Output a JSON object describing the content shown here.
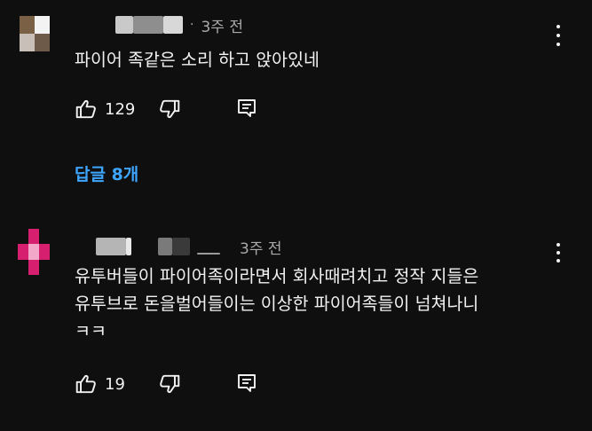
{
  "comments": [
    {
      "time": "3주 전",
      "text": "파이어 족같은 소리 하고 앉아있네",
      "likes": "129",
      "replies_label": "답글 8개",
      "avatar_colors": [
        "#7a6045",
        "#ffffff",
        "#c8c0b8",
        "#6e5a48"
      ]
    },
    {
      "time": "3주 전",
      "text": "유투버들이 파이어족이라면서 회사때려치고 정작 지들은\n유투브로 돈을벌어들이는 이상한 파이어족들이 넘쳐나니\nㅋㅋ",
      "likes": "19",
      "avatar_colors": [
        "#0f0f0f",
        "#d61f6e",
        "#0f0f0f",
        "#d61f6e",
        "#f2a8c8",
        "#d61f6e",
        "#0f0f0f",
        "#d61f6e",
        "#0f0f0f"
      ]
    }
  ],
  "icons": {
    "like": "thumb-up-icon",
    "dislike": "thumb-down-icon",
    "reply": "reply-icon",
    "menu": "more-vert-icon"
  },
  "colors": {
    "background": "#0f0f0f",
    "link": "#3ea6ff",
    "muted": "#aaaaaa"
  }
}
